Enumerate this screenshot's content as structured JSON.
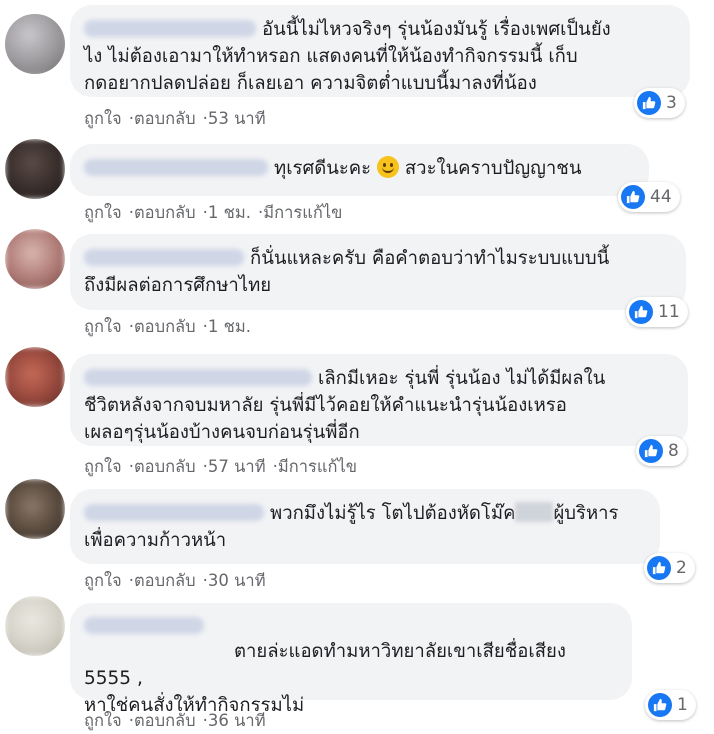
{
  "comments": [
    {
      "lines": [
        "อันนี้ไม่ไหวจริงๆ รุ่นน้องมันรู้ เรื่องเพศเป็นยัง",
        "ไง ไม่ต้องเอามาให้ทำหรอก แสดงคนที่ให้น้องทำกิจกรรมนี้ เก็บ",
        "กดอยากปลดปล่อย ก็เลยเอา ความจิตต่ำแบบนี้มาลงที่น้อง"
      ],
      "reactions": "3",
      "like": "ถูกใจ",
      "reply": "ตอบกลับ",
      "time": "53 นาที",
      "edited": ""
    },
    {
      "lines": [
        "ทุเรศดีนะคะ",
        "สวะในคราบปัญญาชน"
      ],
      "reactions": "44",
      "like": "ถูกใจ",
      "reply": "ตอบกลับ",
      "time": "1 ชม.",
      "edited": "มีการแก้ไข"
    },
    {
      "lines": [
        "ก็นั่นแหละครับ คือคำตอบว่าทำไมระบบแบบนี้",
        "ถึงมีผลต่อการศึกษาไทย"
      ],
      "reactions": "11",
      "like": "ถูกใจ",
      "reply": "ตอบกลับ",
      "time": "1 ชม.",
      "edited": ""
    },
    {
      "lines": [
        "เลิกมีเหอะ รุ่นพี่ รุ่นน้อง ไม่ได้มีผลใน",
        "ชีวิตหลังจากจบมหาลัย รุ่นพี่มีไว้คอยให้คำแนะนำรุ่นน้องเหรอ",
        "เผลอๆรุ่นน้องบ้างคนจบก่อนรุ่นพี่อีก"
      ],
      "reactions": "8",
      "like": "ถูกใจ",
      "reply": "ตอบกลับ",
      "time": "57 นาที",
      "edited": "มีการแก้ไข"
    },
    {
      "lines": [
        "พวกมึงไม่รู้ไร โตไปต้องหัดโม๊ค",
        "ผู้บริหาร",
        "เพื่อความก้าวหน้า"
      ],
      "reactions": "2",
      "like": "ถูกใจ",
      "reply": "ตอบกลับ",
      "time": "30 นาที",
      "edited": ""
    },
    {
      "lines": [
        "ตายล่ะแอดทำมหาวิทยาลัยเขาเสียชื่อเสียง",
        "5555 ,",
        "หาใช่คนสั่งให้ทำกิจกรรมไม่"
      ],
      "reactions": "1",
      "like": "ถูกใจ",
      "reply": "ตอบกลับ",
      "time": "36 นาที",
      "edited": ""
    }
  ],
  "colors": {
    "bubble": "#f2f3f5",
    "meta_text": "#65676b",
    "like_blue": "#1877f2",
    "name_blur": "#cfd6e6"
  },
  "icons": {
    "like": "thumbs-up-icon",
    "emoji": "smiling-face-icon"
  }
}
